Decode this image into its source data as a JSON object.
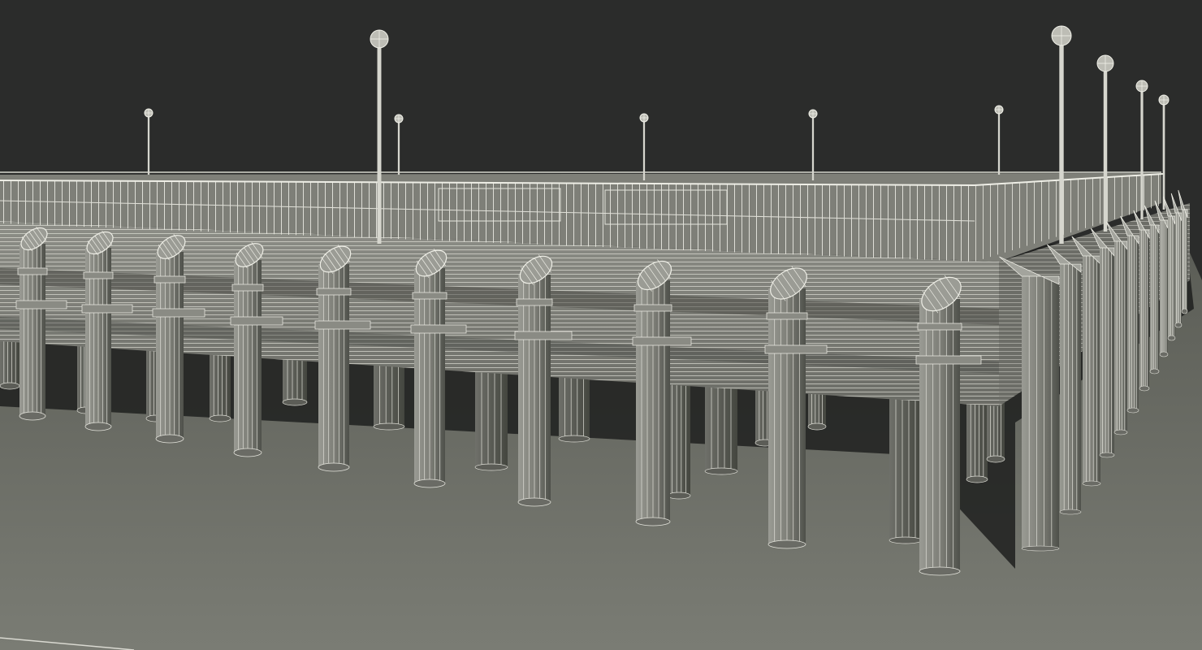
{
  "scene": {
    "subject": "pier-wireframe-render",
    "colors": {
      "sky": "#2b2c2b",
      "ground_far": "#6f716a",
      "ground_near": "#7b7d75",
      "pile_light": "#8c8d86",
      "pile_dark": "#55574f",
      "deck": "#7d7e77",
      "wire": "#e4e4dc",
      "shadow": "#3a3b37"
    }
  }
}
